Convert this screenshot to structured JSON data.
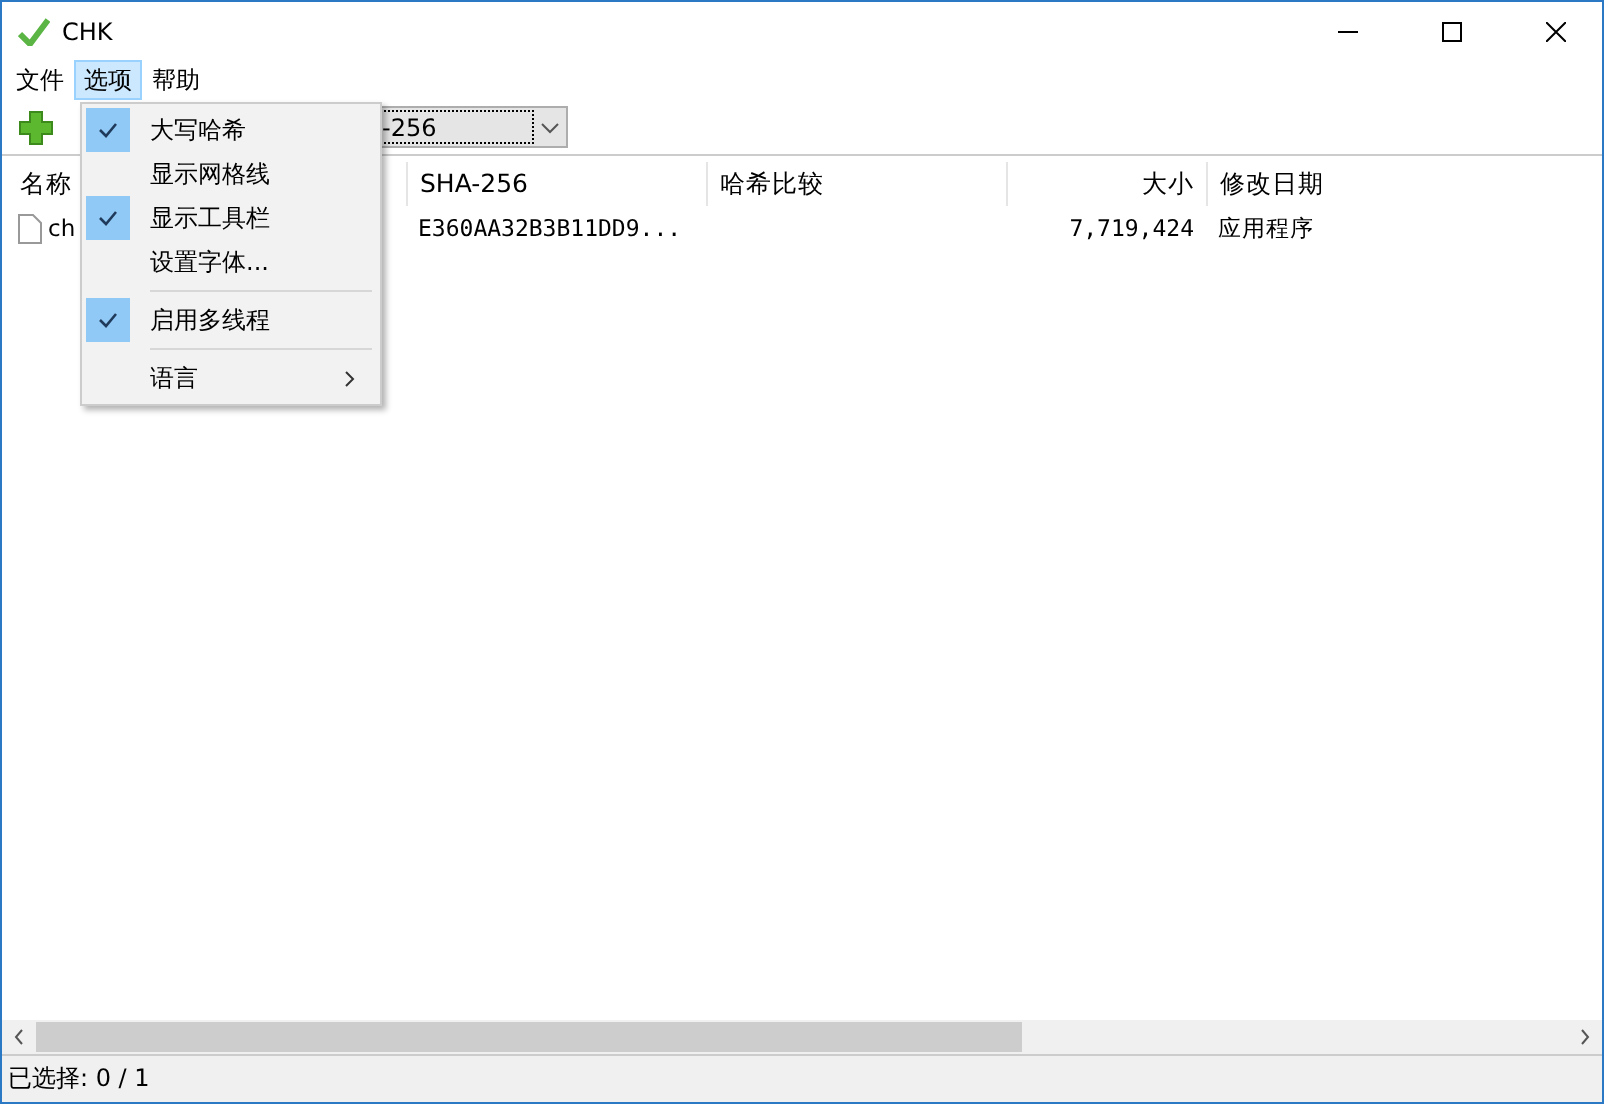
{
  "window": {
    "title": "CHK"
  },
  "menu_bar": [
    {
      "label": "文件",
      "selected": false
    },
    {
      "label": "选项",
      "selected": true
    },
    {
      "label": "帮助",
      "selected": false
    }
  ],
  "toolbar": {
    "hash_combo": {
      "value": "-256"
    }
  },
  "table": {
    "columns": [
      {
        "label": "名称",
        "kind": "text"
      },
      {
        "label": "SHA-256",
        "kind": "text"
      },
      {
        "label": "哈希比较",
        "kind": "text"
      },
      {
        "label": "大小",
        "kind": "number"
      },
      {
        "label": "修改日期",
        "kind": "text"
      }
    ],
    "rows": [
      {
        "cells": [
          "ch",
          "E360AA32B3B11DD9...",
          "",
          "7,719,424",
          "应用程序"
        ]
      }
    ]
  },
  "options_menu": [
    {
      "kind": "item",
      "label": "大写哈希",
      "checked": true
    },
    {
      "kind": "item",
      "label": "显示网格线",
      "checked": false
    },
    {
      "kind": "item",
      "label": "显示工具栏",
      "checked": true
    },
    {
      "kind": "item",
      "label": "设置字体...",
      "checked": false
    },
    {
      "kind": "separator"
    },
    {
      "kind": "item",
      "label": "启用多线程",
      "checked": true
    },
    {
      "kind": "separator"
    },
    {
      "kind": "submenu",
      "label": "语言"
    }
  ],
  "status_bar": {
    "text": "已选择: 0 / 1"
  }
}
